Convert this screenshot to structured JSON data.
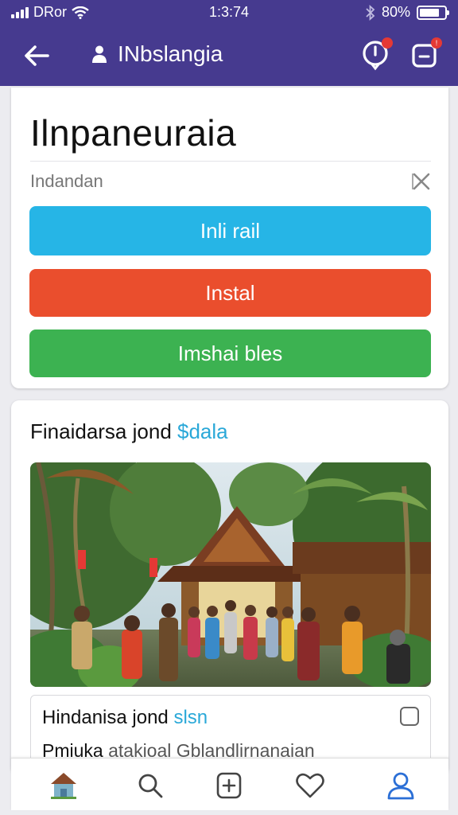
{
  "status": {
    "carrier": "DRor",
    "time": "1:3:74",
    "battery": "80%",
    "battery_level": 0.8
  },
  "appbar": {
    "title": "INbslangia"
  },
  "header": {
    "heading": "Ilnpaneuraia",
    "search": {
      "placeholder": "Indandan"
    },
    "buttons": [
      {
        "label": "Inli rail",
        "color": "#26b5e6"
      },
      {
        "label": "Instal",
        "color": "#ea4e2d"
      },
      {
        "label": "Imshai bles",
        "color": "#3cb251"
      }
    ]
  },
  "post": {
    "title": "Finaidarsa jond",
    "title_link": "$dala",
    "caption": {
      "title": "Hindanisa jond",
      "title_link": "slsn",
      "text": "Pmiuka",
      "text_rest": "atakioal Gblandlirnanaian"
    }
  },
  "colors": {
    "appbar": "#463a8f",
    "accent_link": "#2aa8d8",
    "active_nav": "#2b6fd6"
  },
  "nav": {
    "items": [
      "home-icon",
      "search-icon",
      "add-icon",
      "heart-icon",
      "profile-icon"
    ]
  }
}
